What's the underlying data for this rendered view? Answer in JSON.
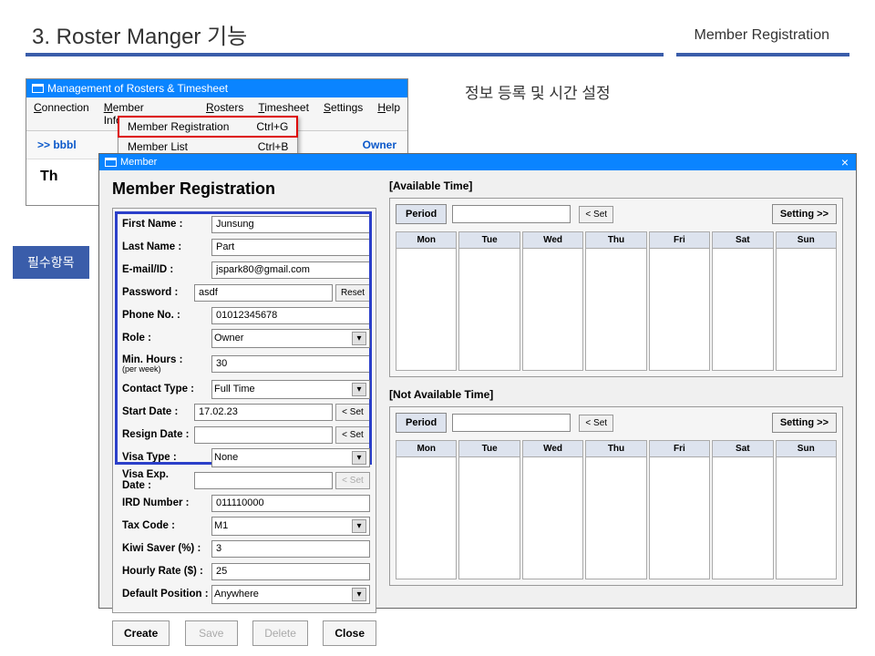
{
  "slide": {
    "title": "3. Roster Manger 기능",
    "subtitle": "Member Registration",
    "korean_caption": "정보 등록 및 시간 설정",
    "callout": "필수항목"
  },
  "main_window": {
    "title": "Management of Rosters & Timesheet",
    "menus": [
      "Connection",
      "Member Information",
      "Rosters",
      "Timesheet",
      "Settings",
      "Help"
    ],
    "dropdown": [
      {
        "label": "Member Registration",
        "shortcut": "Ctrl+G",
        "highlighted": true
      },
      {
        "label": "Member List",
        "shortcut": "Ctrl+B",
        "highlighted": false
      }
    ],
    "crumb_left": ">> bbbl",
    "crumb_right": "Owner",
    "body_text": "Th"
  },
  "member": {
    "title": "Member",
    "heading": "Member Registration",
    "fields": {
      "first_name": {
        "label": "First Name :",
        "value": "Junsung"
      },
      "last_name": {
        "label": "Last Name :",
        "value": "Part"
      },
      "email": {
        "label": "E-mail/ID :",
        "value": "jspark80@gmail.com"
      },
      "password": {
        "label": "Password :",
        "value": "asdf",
        "reset": "Reset"
      },
      "phone": {
        "label": "Phone No. :",
        "value": "01012345678"
      },
      "role": {
        "label": "Role :",
        "value": "Owner"
      },
      "min_hours": {
        "label": "Min. Hours :",
        "sub": "(per week)",
        "value": "30"
      },
      "contract": {
        "label": "Contact Type :",
        "value": "Full Time"
      },
      "start_date": {
        "label": "Start Date :",
        "value": "17.02.23",
        "btn": "< Set"
      },
      "resign_date": {
        "label": "Resign Date :",
        "value": "",
        "btn": "< Set"
      },
      "visa_type": {
        "label": "Visa Type :",
        "value": "None"
      },
      "visa_exp": {
        "label": "Visa Exp. Date :",
        "value": "",
        "btn": "< Set"
      },
      "ird": {
        "label": "IRD Number :",
        "value": "011110000"
      },
      "tax": {
        "label": "Tax Code :",
        "value": "M1"
      },
      "kiwi": {
        "label": "Kiwi Saver (%) :",
        "value": "3"
      },
      "rate": {
        "label": "Hourly Rate ($) :",
        "value": "25"
      },
      "position": {
        "label": "Default Position :",
        "value": "Anywhere"
      }
    },
    "actions": {
      "create": "Create",
      "save": "Save",
      "delete": "Delete",
      "close": "Close"
    },
    "avail": {
      "title": "[Available Time]",
      "period": "Period",
      "set": "< Set",
      "setting": "Setting >>",
      "days": [
        "Mon",
        "Tue",
        "Wed",
        "Thu",
        "Fri",
        "Sat",
        "Sun"
      ]
    },
    "not_avail": {
      "title": "[Not Available Time]",
      "period": "Period",
      "set": "< Set",
      "setting": "Setting >>",
      "days": [
        "Mon",
        "Tue",
        "Wed",
        "Thu",
        "Fri",
        "Sat",
        "Sun"
      ]
    }
  }
}
